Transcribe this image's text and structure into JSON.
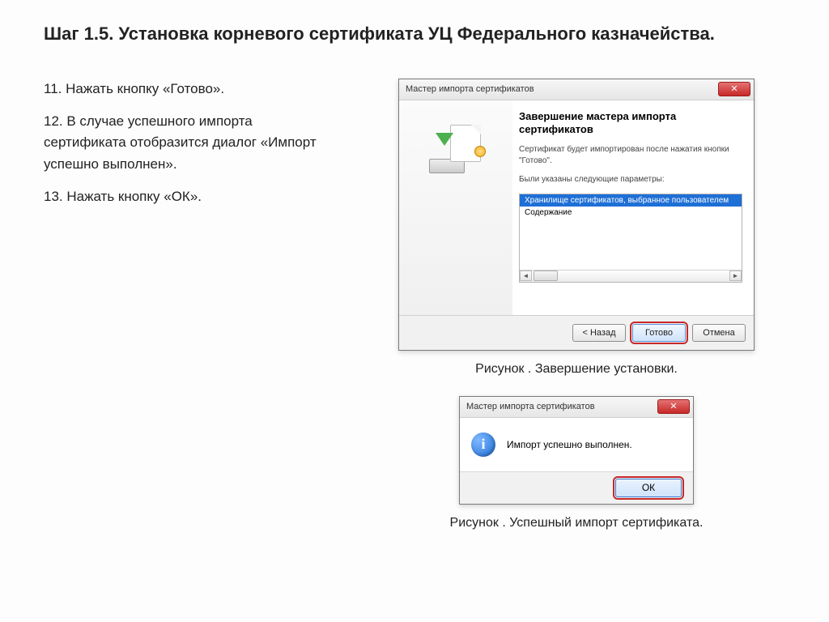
{
  "page": {
    "title": "Шаг 1.5. Установка корневого сертификата УЦ Федерального казначейства."
  },
  "steps": {
    "s11": "11. Нажать кнопку «Готово».",
    "s12": "12. В случае успешного импорта сертификата отобразится диалог «Импорт успешно выполнен».",
    "s13": "13. Нажать кнопку «ОК»."
  },
  "wizard": {
    "window_title": "Мастер импорта сертификатов",
    "heading": "Завершение мастера импорта сертификатов",
    "desc": "Сертификат будет импортирован после нажатия кнопки \"Готово\".",
    "params_label": "Были указаны следующие параметры:",
    "row_selected": "Хранилище сертификатов, выбранное пользователем",
    "row_content": "Содержание",
    "btn_back": "< Назад",
    "btn_finish": "Готово",
    "btn_cancel": "Отмена"
  },
  "captions": {
    "fig1": "Рисунок . Завершение установки.",
    "fig2": "Рисунок . Успешный импорт сертификата."
  },
  "msgbox": {
    "title": "Мастер импорта сертификатов",
    "text": "Импорт успешно выполнен.",
    "ok": "ОК"
  }
}
